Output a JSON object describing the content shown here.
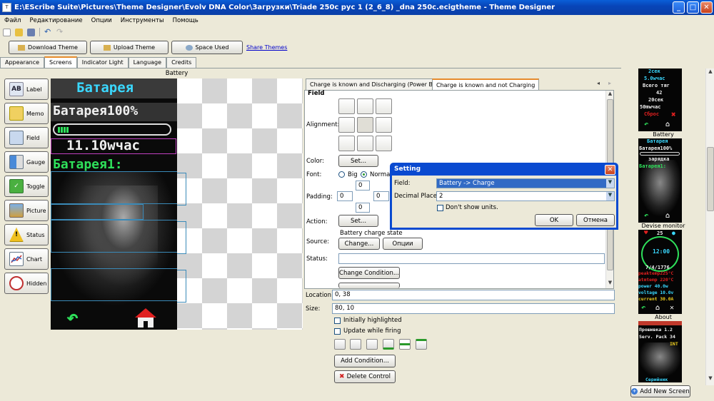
{
  "window": {
    "title": "E:\\EScribe Suite\\Pictures\\Theme Designer\\Evolv DNA Color\\Загрузки\\Triade 250c рус 1 (2_6_8) _dna 250c.ecigtheme - Theme Designer",
    "minimize": "_",
    "maximize": "□",
    "close": "✕"
  },
  "menu": [
    "Файл",
    "Редактирование",
    "Опции",
    "Инструменты",
    "Помощь"
  ],
  "toolbar": {
    "download_label": "Download Theme",
    "upload_label": "Upload Theme",
    "space_label": "Space Used",
    "share_label": "Share Themes"
  },
  "tabs": [
    "Appearance",
    "Screens",
    "Indicator Light",
    "Language",
    "Credits"
  ],
  "active_tab": "Screens",
  "controls": [
    "Label",
    "Memo",
    "Field",
    "Gauge",
    "Toggle",
    "Picture",
    "Status",
    "Chart",
    "Hidden"
  ],
  "control_icon_text": [
    "AB",
    "",
    "",
    "",
    "✓",
    "",
    "!",
    "",
    ""
  ],
  "screen_title": "Battery",
  "device": {
    "label1": "Батарея",
    "label2": "Батарея100%",
    "value": "11.10wчас",
    "label3": "Батарея1:"
  },
  "panel": {
    "tab1": "Charge is known and Discharging (Power Bank)",
    "tab2": "Charge is known and not Charging",
    "nav_left": "◂",
    "nav_right": "▸",
    "section": "Field",
    "alignment_label": "Alignment:",
    "color_label": "Color:",
    "color_btn": "Set...",
    "font_label": "Font:",
    "font_big": "Big",
    "font_normal": "Normal",
    "padding_label": "Padding:",
    "pad_top": "0",
    "pad_left": "0",
    "pad_right": "0",
    "pad_bottom": "0",
    "action_label": "Action:",
    "action_btn": "Set...",
    "source_label": "Source:",
    "source_value": "Battery charge state",
    "source_change": "Change...",
    "source_options": "Опции",
    "status_label": "Status:",
    "status_value": "",
    "change_condition": "Change Condition..."
  },
  "props": {
    "location_label": "Location:",
    "location_value": "0, 38",
    "size_label": "Size:",
    "size_value": "80, 10",
    "initially_highlighted": "Initially highlighted",
    "update_while_firing": "Update while firing",
    "add_condition": "Add Condition...",
    "delete_control": "Delete Control"
  },
  "dialog": {
    "title": "Setting",
    "field_label": "Field:",
    "field_value": "Battery -> Charge",
    "decimal_label": "Decimal Places:",
    "decimal_value": "2",
    "dont_show_units": "Don't show units.",
    "ok": "OK",
    "cancel": "Отмена",
    "close": "✕"
  },
  "thumbs": {
    "t1_lines": [
      "2сек",
      "5.0wчас",
      "Всего тяг",
      "42",
      "20сек",
      "50mwчас",
      "Сброс"
    ],
    "t1_cap": "Battery",
    "t2_lines": [
      "Батарея",
      "Батарея100%",
      "",
      "зарядка",
      "Батарея1:"
    ],
    "t2_cap": "Devise monitor",
    "t3_lines": [
      "25",
      "12:00",
      "7/4/1776",
      "peaktemp225°C",
      "atmtemp 220°C",
      "power   40.0w",
      "voltage 10.0v",
      "current 30.0A"
    ],
    "t3_cap": "About",
    "t4_lines": [
      "Прошивка  1.2",
      "Serv. Pack  34",
      "INT",
      "Серийник"
    ],
    "add_screen": "Add New Screen"
  },
  "colors": {
    "cyan": "#3ad8ff",
    "white": "#f0f0f0",
    "green": "#2ee05a",
    "red": "#e02020",
    "accent": "#0a4ad0"
  }
}
